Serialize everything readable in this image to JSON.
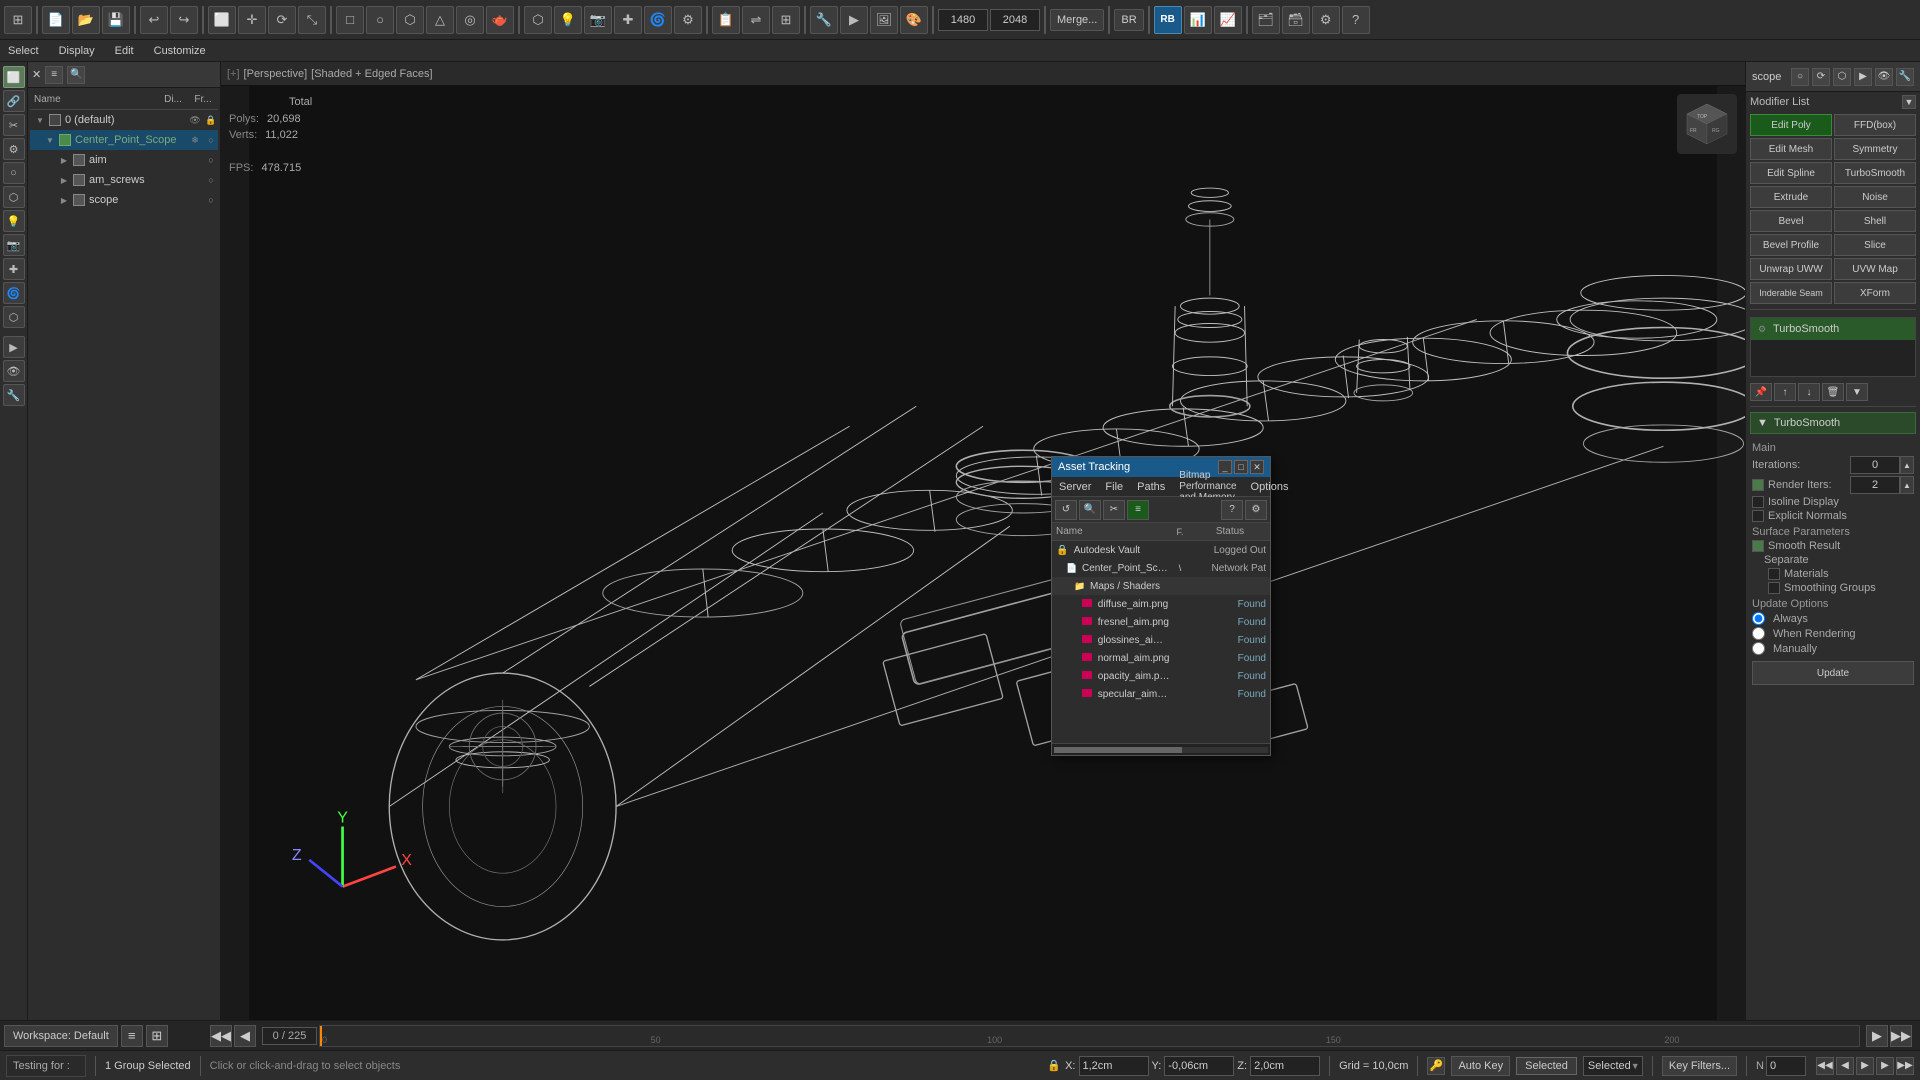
{
  "app": {
    "title": "3ds Max"
  },
  "toolbar": {
    "icons": [
      "⌂",
      "📁",
      "💾",
      "↩",
      "↪",
      "□",
      "○",
      "◇",
      "△",
      "⬡",
      "⬟",
      "✦",
      "⚙",
      "↕",
      "↔",
      "⟳",
      "⊕",
      "🔍",
      "🖱",
      "✎",
      "📐",
      "📏",
      "📌",
      "🔗",
      "🎯",
      "💡",
      "🔧",
      "📊"
    ],
    "merge_label": "Merge...",
    "br_label": "BR",
    "width_value": "1480",
    "height_value": "2048"
  },
  "menubar": {
    "items": [
      "Select",
      "Display",
      "Edit",
      "Customize"
    ]
  },
  "scene_explorer": {
    "name_col": "Name",
    "di_col": "Di...",
    "fr_col": "Fr...",
    "root_layer": "0 (default)",
    "selected_object": "Center_Point_Scope",
    "children": [
      {
        "name": "aim",
        "indent": 2
      },
      {
        "name": "am_screws",
        "indent": 2
      },
      {
        "name": "scope",
        "indent": 2
      }
    ]
  },
  "viewport": {
    "bracket1": "[+]",
    "label1": "[Perspective]",
    "label2": "[Shaded + Edged Faces]",
    "stats": {
      "total_label": "Total",
      "polys_label": "Polys:",
      "polys_value": "20,698",
      "verts_label": "Verts:",
      "verts_value": "11,022",
      "fps_label": "FPS:",
      "fps_value": "478.715"
    },
    "nav_position": "0 / 225",
    "axes": {
      "x": "X",
      "y": "Y",
      "z": "Z"
    }
  },
  "modifier_panel": {
    "scope_label": "scope",
    "modifier_list_label": "Modifier List",
    "modifiers": {
      "edit_poly": "Edit Poly",
      "ffd_box": "FFD(box)",
      "edit_mesh": "Edit Mesh",
      "symmetry": "Symmetry",
      "edit_spline": "Edit Spline",
      "turbo_smooth": "TurboSmooth",
      "extrude": "Extrude",
      "noise": "Noise",
      "bevel": "Bevel",
      "shell": "Shell",
      "bevel_profile": "Bevel Profile",
      "slice": "Slice",
      "unwrap_uvw": "Unwrap UWW",
      "uvw_map": "UVW Map",
      "bendable_seam": "Inderable Seam",
      "xform": "XForm"
    },
    "stack_item": "TurboSmooth",
    "turbosmooth": {
      "section_title": "TurboSmooth",
      "main_label": "Main",
      "iterations_label": "Iterations:",
      "iterations_value": "0",
      "render_iters_label": "Render Iters:",
      "render_iters_value": "2",
      "isoline_display": "Isoline Display",
      "explicit_normals": "Explicit Normals",
      "surface_params_label": "Surface Parameters",
      "smooth_result": "Smooth Result",
      "separate_label": "Separate",
      "materials": "Materials",
      "smoothing_groups": "Smoothing Groups",
      "update_options_label": "Update Options",
      "always": "Always",
      "when_rendering": "When Rendering",
      "manually": "Manually",
      "update_btn": "Update"
    }
  },
  "asset_tracking": {
    "title": "Asset Tracking",
    "menus": [
      "Server",
      "File",
      "Paths",
      "Bitmap Performance and Memory",
      "Options"
    ],
    "col_name": "Name",
    "col_f": "F.",
    "col_status": "Status",
    "rows": [
      {
        "name": "Autodesk Vault",
        "indent": 0,
        "type": "vault",
        "f": "",
        "status": "Logged Out"
      },
      {
        "name": "Center_Point_Scope_vra...",
        "indent": 1,
        "type": "file",
        "f": "\\",
        "status": "Network Pat"
      },
      {
        "name": "Maps / Shaders",
        "indent": 1,
        "type": "folder",
        "f": "",
        "status": ""
      },
      {
        "name": "diffuse_aim.png",
        "indent": 2,
        "type": "map",
        "f": "",
        "status": "Found"
      },
      {
        "name": "fresnel_aim.png",
        "indent": 2,
        "type": "map",
        "f": "",
        "status": "Found"
      },
      {
        "name": "glossines_aim.png",
        "indent": 2,
        "type": "map",
        "f": "",
        "status": "Found"
      },
      {
        "name": "normal_aim.png",
        "indent": 2,
        "type": "map",
        "f": "",
        "status": "Found"
      },
      {
        "name": "opacity_aim.png",
        "indent": 2,
        "type": "map",
        "f": "",
        "status": "Found"
      },
      {
        "name": "specular_aim.png",
        "indent": 2,
        "type": "map",
        "f": "",
        "status": "Found"
      }
    ]
  },
  "status_bar": {
    "group_selected": "1 Group Selected",
    "hint": "Click or click-and-drag to select objects",
    "x_label": "X:",
    "x_value": "1,2cm",
    "y_label": "Y:",
    "y_value": "-0,06cm",
    "z_label": "Z:",
    "z_value": "2,0cm",
    "grid_label": "Grid = 10,0cm",
    "auto_key_label": "Auto Key",
    "selected_label": "Selected",
    "key_filters": "Key Filters...",
    "n_value": "0"
  },
  "timeline": {
    "position": "0 / 225",
    "ticks": [
      0,
      50,
      100,
      150,
      200
    ],
    "workspace": "Workspace: Default"
  },
  "testing_label": "Testing for :"
}
